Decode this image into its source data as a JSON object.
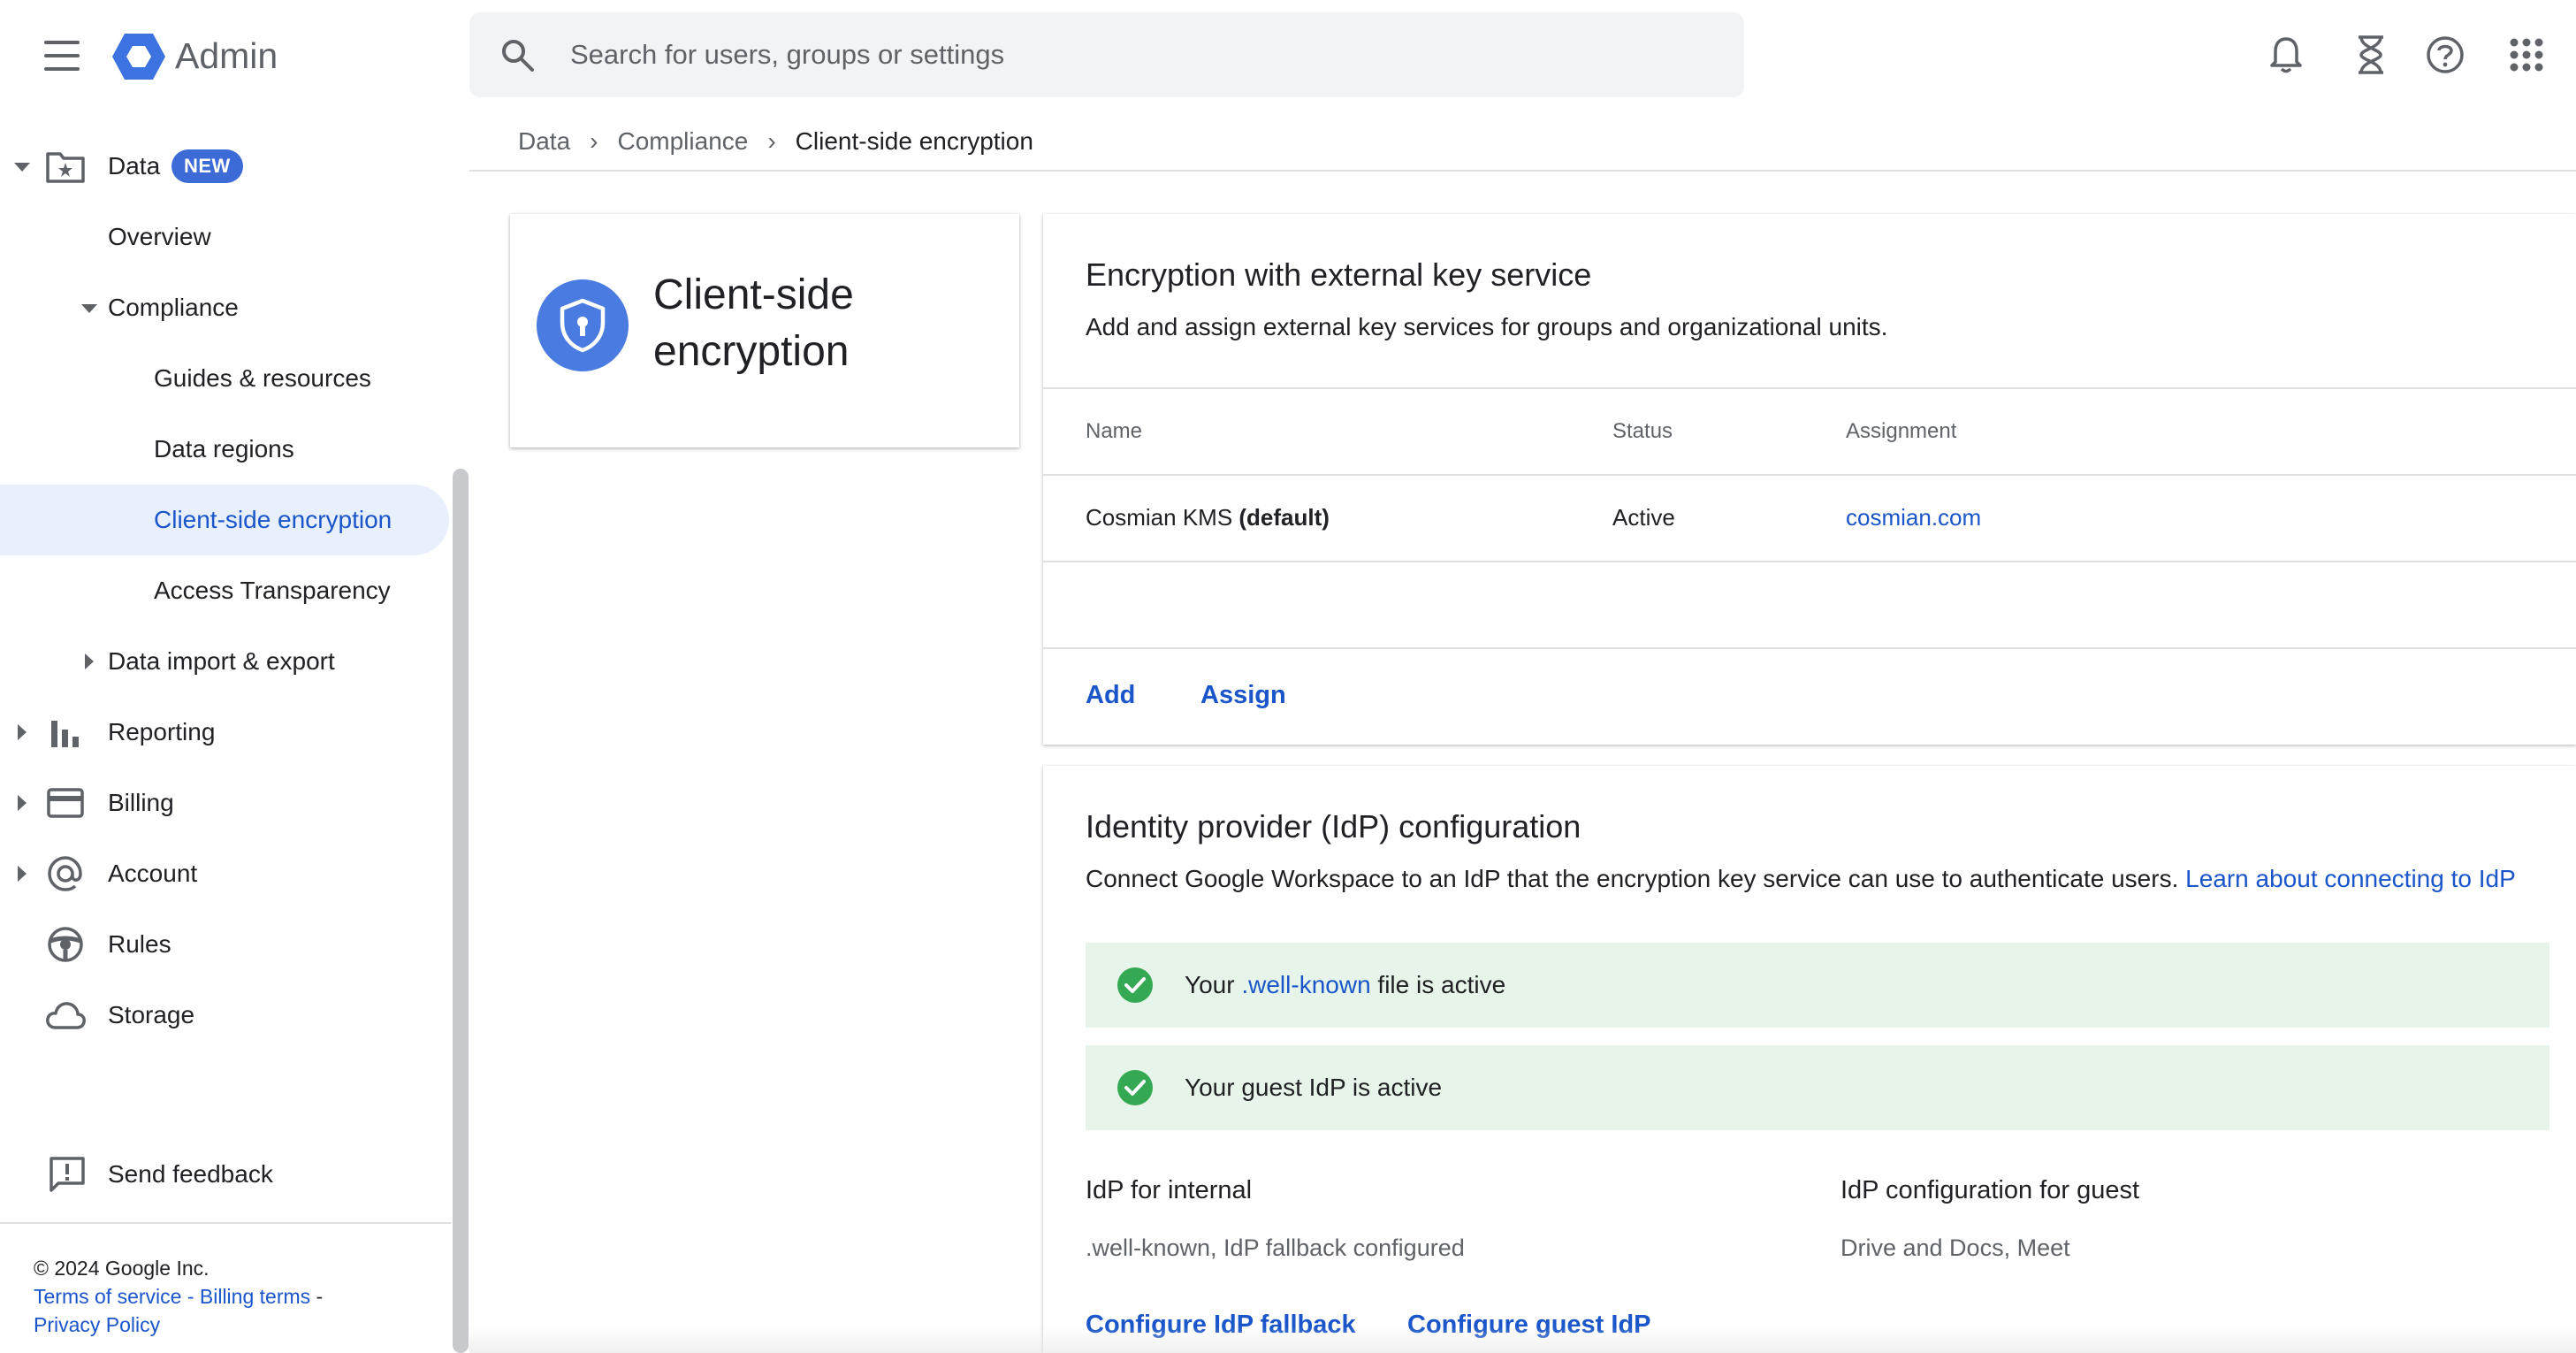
{
  "app": {
    "title": "Admin"
  },
  "search": {
    "placeholder": "Search for users, groups or settings"
  },
  "top_icons": [
    "bell-icon",
    "hourglass-icon",
    "help-icon",
    "apps-grid-icon"
  ],
  "sidebar": {
    "data_label": "Data",
    "data_badge": "NEW",
    "overview": "Overview",
    "compliance": "Compliance",
    "guides": "Guides & resources",
    "data_regions": "Data regions",
    "cse": "Client-side encryption",
    "access_transparency": "Access Transparency",
    "data_import_export": "Data import & export",
    "reporting": "Reporting",
    "billing": "Billing",
    "account": "Account",
    "rules": "Rules",
    "storage": "Storage",
    "send_feedback": "Send feedback"
  },
  "footer": {
    "copyright": "© 2024 Google Inc.",
    "terms": "Terms of service",
    "sep1": " - ",
    "billing_terms": "Billing terms",
    "sep2": " -",
    "privacy": "Privacy Policy"
  },
  "breadcrumb": {
    "items": [
      "Data",
      "Compliance"
    ],
    "current": "Client-side encryption",
    "separator": "›"
  },
  "title_card": {
    "title": "Client-side encryption"
  },
  "key_service": {
    "heading": "Encryption with external key service",
    "description": "Add and assign external key services for groups and organizational units.",
    "columns": {
      "name": "Name",
      "status": "Status",
      "assignment": "Assignment"
    },
    "rows": [
      {
        "name": "Cosmian KMS",
        "name_suffix": "(default)",
        "status": "Active",
        "assignment": "cosmian.com"
      }
    ],
    "add_label": "Add",
    "assign_label": "Assign"
  },
  "idp": {
    "heading": "Identity provider (IdP) configuration",
    "description": "Connect Google Workspace to an IdP that the encryption key service can use to authenticate users.",
    "learn_link": "Learn about connecting to IdP",
    "banner1_prefix": "Your",
    "banner1_link": ".well-known",
    "banner1_suffix": "file is active",
    "banner2": "Your guest IdP is active",
    "internal_heading": "IdP for internal",
    "internal_value": ".well-known, IdP fallback configured",
    "guest_heading": "IdP configuration for guest",
    "guest_value": "Drive and Docs, Meet",
    "configure_fallback": "Configure IdP fallback",
    "configure_guest": "Configure guest IdP"
  },
  "colors": {
    "accent": "#1a56c9",
    "badge": "#3c6ad6",
    "success_bg": "#e6f4ea",
    "success": "#34a853",
    "active_nav_bg": "#e8f0fe"
  }
}
